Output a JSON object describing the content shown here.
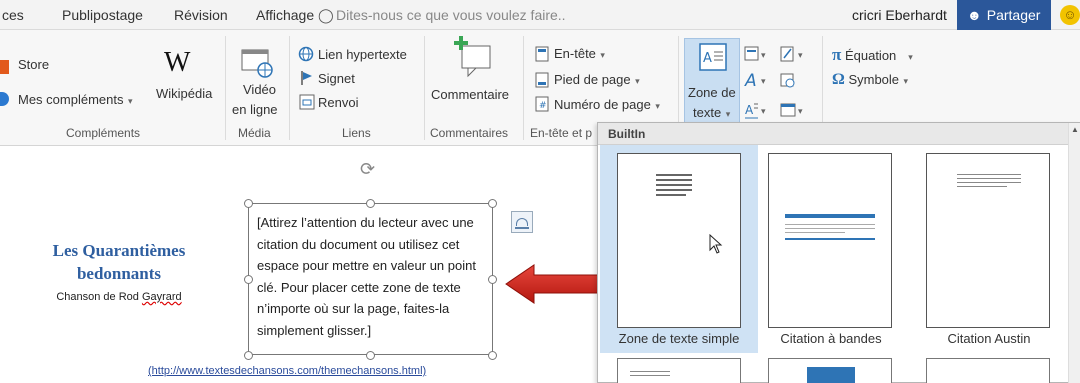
{
  "tabs": {
    "partial_left": "ces",
    "publipostage": "Publipostage",
    "revision": "Révision",
    "affichage": "Affichage"
  },
  "tell_me": {
    "placeholder": "Dites-nous ce que vous voulez faire.."
  },
  "user": {
    "name": "cricri Eberhardt"
  },
  "share": {
    "label": "Partager"
  },
  "ribbon": {
    "complements": {
      "store": "Store",
      "mes_complements": "Mes compléments",
      "wikipedia": "Wikipédia",
      "label": "Compléments"
    },
    "media": {
      "video_line1": "Vidéo",
      "video_line2": "en ligne",
      "label": "Média"
    },
    "liens": {
      "lien_hypertexte": "Lien hypertexte",
      "signet": "Signet",
      "renvoi": "Renvoi",
      "label": "Liens"
    },
    "commentaires": {
      "commentaire": "Commentaire",
      "label": "Commentaires"
    },
    "entete_pied": {
      "en_tete": "En-tête",
      "pied_de_page": "Pied de page",
      "numero_de_page": "Numéro de page",
      "label": "En-tête et p"
    },
    "texte": {
      "zone_line1": "Zone de",
      "zone_line2": "texte"
    },
    "symboles": {
      "equation": "Équation",
      "symbole": "Symbole"
    }
  },
  "document": {
    "title_line1": "Les Quarantièmes",
    "title_line2": "bedonnants",
    "subtitle_prefix": "Chanson de Rod ",
    "subtitle_name": "Gayrard",
    "textbox": "[Attirez l’attention du lecteur avec une citation du document ou utilisez cet espace pour mettre en valeur un point clé. Pour placer cette zone de texte n’importe où sur la page, faites-la simplement glisser.]",
    "link": "(http://www.textesdechansons.com/themechansons.html)"
  },
  "gallery": {
    "header": "BuiltIn",
    "items": [
      {
        "label": "Zone de texte simple",
        "selected": true
      },
      {
        "label": "Citation à bandes",
        "selected": false
      },
      {
        "label": "Citation Austin",
        "selected": false
      }
    ]
  },
  "colors": {
    "share_bg": "#2b579a",
    "title_blue": "#2f5fa0",
    "arrow_red": "#d42a21",
    "selected_bg": "#cfe2f4"
  }
}
